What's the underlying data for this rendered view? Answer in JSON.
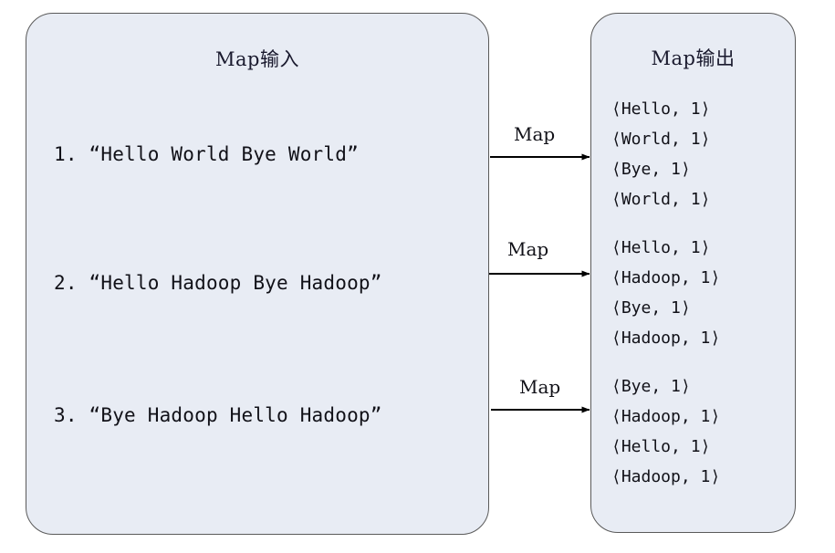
{
  "diagram": {
    "title_semantic": "MapReduce Map phase input/output illustration",
    "background_color": "#ffffff",
    "panel_fill": "#e8ecf4",
    "panel_border": "#5a5a5a",
    "text_color": "#111118"
  },
  "input_panel": {
    "title": "Map输入",
    "lines": [
      "1. “Hello World Bye World”",
      "2. “Hello Hadoop Bye Hadoop”",
      "3. “Bye Hadoop Hello Hadoop”"
    ]
  },
  "output_panel": {
    "title": "Map输出",
    "groups": [
      {
        "lines": [
          "⟨Hello, 1⟩",
          "⟨World, 1⟩",
          "⟨Bye, 1⟩",
          "⟨World, 1⟩"
        ]
      },
      {
        "lines": [
          "⟨Hello, 1⟩",
          "⟨Hadoop, 1⟩",
          "⟨Bye, 1⟩",
          "⟨Hadoop, 1⟩"
        ]
      },
      {
        "lines": [
          "⟨Bye, 1⟩",
          "⟨Hadoop, 1⟩",
          "⟨Hello, 1⟩",
          "⟨Hadoop, 1⟩"
        ]
      }
    ]
  },
  "arrows": [
    {
      "label": "Map"
    },
    {
      "label": "Map"
    },
    {
      "label": "Map"
    }
  ]
}
